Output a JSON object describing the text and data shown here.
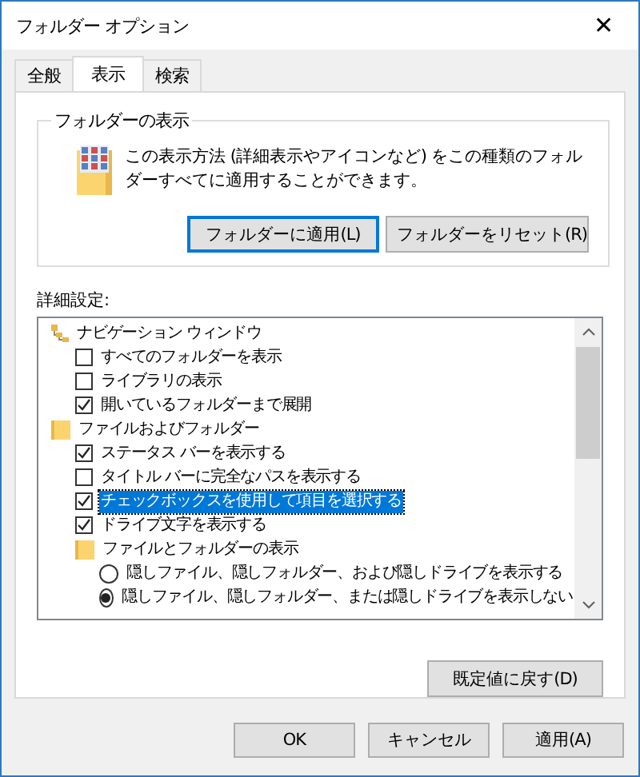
{
  "window": {
    "title": "フォルダー オプション",
    "close": "✕"
  },
  "tabs": [
    {
      "label": "全般",
      "selected": false
    },
    {
      "label": "表示",
      "selected": true
    },
    {
      "label": "検索",
      "selected": false
    }
  ],
  "folder_views": {
    "title": "フォルダーの表示",
    "description": "この表示方法 (詳細表示やアイコンなど) をこの種類のフォルダーすべてに適用することができます。",
    "buttons": [
      {
        "label": "フォルダーに適用(L)",
        "focused": true
      },
      {
        "label": "フォルダーをリセット(R)",
        "focused": false
      }
    ]
  },
  "advanced": {
    "label": "詳細設定:",
    "items": [
      {
        "kind": "navigation",
        "label": "ナビゲーション ウィンドウ",
        "selected": false,
        "children": [
          {
            "kind": "checkbox",
            "label": "すべてのフォルダーを表示",
            "checked": false,
            "selected": false
          },
          {
            "kind": "checkbox",
            "label": "ライブラリの表示",
            "checked": false,
            "selected": false
          },
          {
            "kind": "checkbox",
            "label": "開いているフォルダーまで展開",
            "checked": true,
            "selected": false
          }
        ]
      },
      {
        "kind": "folder",
        "label": "ファイルおよびフォルダー",
        "selected": false,
        "children": [
          {
            "kind": "checkbox",
            "label": "ステータス バーを表示する",
            "checked": true,
            "selected": false
          },
          {
            "kind": "checkbox",
            "label": "タイトル バーに完全なパスを表示する",
            "checked": false,
            "selected": false
          },
          {
            "kind": "checkbox",
            "label": "チェックボックスを使用して項目を選択する",
            "checked": true,
            "selected": true
          },
          {
            "kind": "checkbox",
            "label": "ドライブ文字を表示する",
            "checked": true,
            "selected": false
          },
          {
            "kind": "folder",
            "label": "ファイルとフォルダーの表示",
            "selected": false,
            "children": [
              {
                "kind": "radio",
                "label": "隠しファイル、隠しフォルダー、および隠しドライブを表示する",
                "checked": false,
                "selected": false
              },
              {
                "kind": "radio",
                "label": "隠しファイル、隠しフォルダー、または隠しドライブを表示しない",
                "checked": true,
                "selected": false
              }
            ]
          }
        ]
      }
    ],
    "restore_button": "既定値に戻す(D)"
  },
  "buttons": [
    "OK",
    "キャンセル",
    "適用(A)"
  ]
}
